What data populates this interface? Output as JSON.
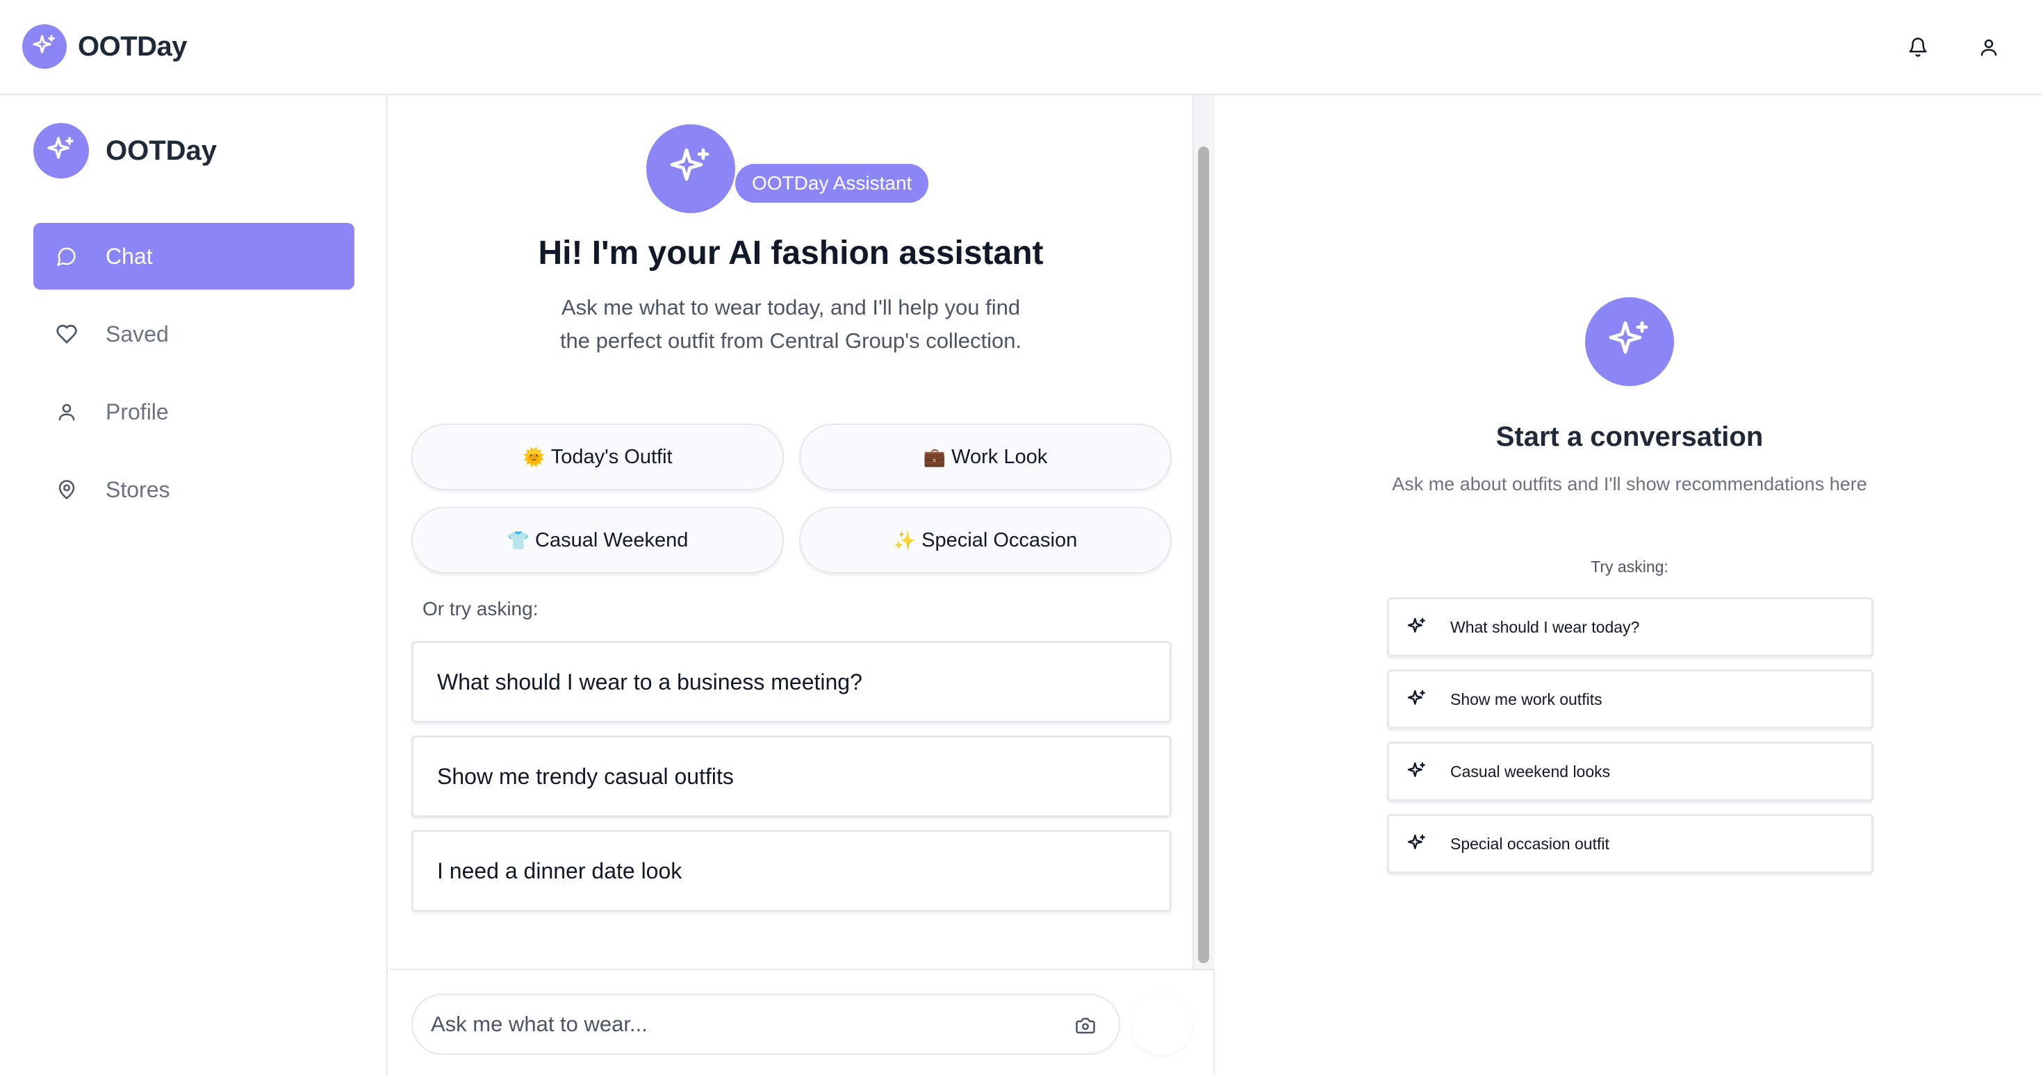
{
  "app": {
    "name": "OOTDay"
  },
  "sidebar": {
    "brand": "OOTDay",
    "items": [
      {
        "label": "Chat",
        "icon": "chat-bubble-icon",
        "active": true
      },
      {
        "label": "Saved",
        "icon": "heart-icon",
        "active": false
      },
      {
        "label": "Profile",
        "icon": "user-icon",
        "active": false
      },
      {
        "label": "Stores",
        "icon": "map-pin-icon",
        "active": false
      }
    ]
  },
  "chat": {
    "badge": "OOTDay Assistant",
    "title": "Hi! I'm your AI fashion assistant",
    "subtitle": "Ask me what to wear today, and I'll help you find the perfect outfit from Central Group's collection.",
    "quick_actions": [
      {
        "emoji": "🌞",
        "label": "Today's Outfit"
      },
      {
        "emoji": "💼",
        "label": "Work Look"
      },
      {
        "emoji": "👕",
        "label": "Casual Weekend"
      },
      {
        "emoji": "✨",
        "label": "Special Occasion"
      }
    ],
    "try_label": "Or try asking:",
    "suggestions": [
      "What should I wear to a business meeting?",
      "Show me trendy casual outfits",
      "I need a dinner date look"
    ],
    "input_placeholder": "Ask me what to wear..."
  },
  "right_panel": {
    "title": "Start a conversation",
    "subtitle": "Ask me about outfits and I'll show recommendations here",
    "try_label": "Try asking:",
    "suggestions": [
      "What should I wear today?",
      "Show me work outfits",
      "Casual weekend looks",
      "Special occasion outfit"
    ]
  },
  "colors": {
    "accent": "#8b85f5",
    "text": "#111827",
    "muted": "#6b7280",
    "border": "#e5e7eb"
  }
}
